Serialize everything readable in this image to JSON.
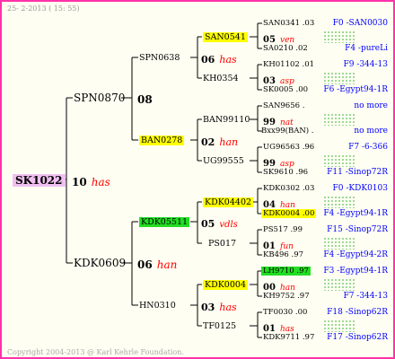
{
  "header": "25-  2-2013 ( 15: 55)",
  "footer": "Copyright 2004-2013 @ Karl Kehrle Foundation.",
  "watermark": "Karl Kehrle Foundation",
  "root": {
    "id": "SK1022",
    "num": "10",
    "trait": "has"
  },
  "gen1": [
    {
      "id": "SPN0870",
      "num": "08",
      "trait": ""
    },
    {
      "id": "KDK0609",
      "num": "06",
      "trait": "han"
    }
  ],
  "gen2": [
    {
      "id": "SPN0638",
      "num": "06",
      "trait": "has"
    },
    {
      "id": "BAN0278",
      "num": "02",
      "trait": "han"
    },
    {
      "id": "KDK05511",
      "num": "05",
      "trait": "vdls"
    },
    {
      "id": "HN0310",
      "num": "03",
      "trait": "has"
    }
  ],
  "gen3": [
    {
      "id": "SAN0541",
      "num": "05",
      "trait": "ven"
    },
    {
      "id": "KH0354",
      "num": "03",
      "trait": "asp"
    },
    {
      "id": "BAN99110",
      "num": "99",
      "trait": "nat"
    },
    {
      "id": "UG99555",
      "num": "99",
      "trait": "asp"
    },
    {
      "id": "KDK04402",
      "num": "04",
      "trait": "han"
    },
    {
      "id": "PS017",
      "num": "01",
      "trait": "fun"
    },
    {
      "id": "KDK0004",
      "num": "00",
      "trait": "han"
    },
    {
      "id": "TF0125",
      "num": "01",
      "trait": "has"
    }
  ],
  "gen4": [
    {
      "id": "SAN0341 .03",
      "ref": "F0 -SAN0030"
    },
    {
      "id": "SA0210 .02",
      "ref": "F4 -pureLi"
    },
    {
      "id": "KH01102 .01",
      "ref": "F9 -344-13"
    },
    {
      "id": "SK0005 .00",
      "ref": "F6 -Egypt94-1R"
    },
    {
      "id": "SAN9656 .",
      "ref": "no more"
    },
    {
      "id": "Bxx99(BAN) .",
      "ref": "no more"
    },
    {
      "id": "UG96563 .96",
      "ref": "F7 -6-366"
    },
    {
      "id": "SK9610 .96",
      "ref": "F11 -Sinop72R"
    },
    {
      "id": "KDK0302 .03",
      "ref": "F0 -KDK0103"
    },
    {
      "id": "KDK0004 .00",
      "ref": "F4 -Egypt94-1R"
    },
    {
      "id": "PS517 .99",
      "ref": "F15 -Sinop72R"
    },
    {
      "id": "KB496 .97",
      "ref": "F4 -Egypt94-2R"
    },
    {
      "id": "LH9710 .97",
      "ref": "F3 -Egypt94-1R"
    },
    {
      "id": "KH9752 .97",
      "ref": "F7 -344-13"
    },
    {
      "id": "TF0030 .00",
      "ref": "F18 -Sinop62R"
    },
    {
      "id": "KDK9711 .97",
      "ref": "F17 -Sinop62R"
    }
  ],
  "colors": {
    "border": "#ff33aa",
    "highlight_yellow": "#ffff00",
    "highlight_green": "#22dd22",
    "root_bg": "#f0c0f0",
    "ref_text": "#0000ff",
    "trait_text": "#ff0000"
  }
}
